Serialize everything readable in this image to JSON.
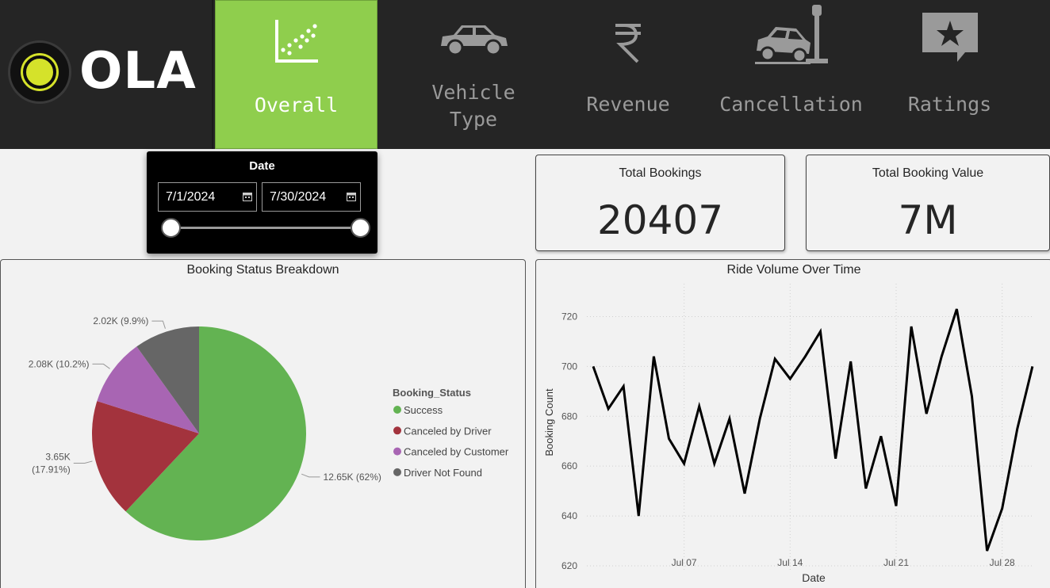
{
  "brand": {
    "name": "OLA"
  },
  "nav": {
    "tabs": [
      {
        "label": "Overall",
        "active": true,
        "icon": "scatter-chart-icon"
      },
      {
        "label_lines": [
          "Vehicle",
          "Type"
        ],
        "active": false,
        "icon": "car-icon"
      },
      {
        "label": "Revenue",
        "active": false,
        "icon": "rupee-icon"
      },
      {
        "label": "Cancellation",
        "active": false,
        "icon": "car-crash-icon"
      },
      {
        "label": "Ratings",
        "active": false,
        "icon": "star-badge-icon"
      }
    ],
    "active_color": "#8fce4d"
  },
  "date_filter": {
    "title": "Date",
    "start": "7/1/2024",
    "end": "7/30/2024"
  },
  "kpis": {
    "total_bookings": {
      "title": "Total Bookings",
      "value": "20407"
    },
    "total_booking_value": {
      "title": "Total Booking Value",
      "value": "7M"
    }
  },
  "chart_data": [
    {
      "type": "pie",
      "title": "Booking Status Breakdown",
      "legend_title": "Booking_Status",
      "legend_position": "right",
      "slices": [
        {
          "name": "Success",
          "value": 12.65,
          "label": "12.65K (62%)",
          "color": "#63b352"
        },
        {
          "name": "Canceled by Driver",
          "value": 3.65,
          "label_lines": [
            "3.65K",
            "(17.91%)"
          ],
          "color": "#a3333d"
        },
        {
          "name": "Canceled by Customer",
          "value": 2.08,
          "label": "2.08K (10.2%)",
          "color": "#a865b3"
        },
        {
          "name": "Driver Not Found",
          "value": 2.02,
          "label": "2.02K (9.9%)",
          "color": "#666666"
        }
      ]
    },
    {
      "type": "line",
      "title": "Ride Volume Over Time",
      "xlabel": "Date",
      "ylabel": "Booking Count",
      "ylim": [
        620,
        730
      ],
      "yticks": [
        620,
        640,
        660,
        680,
        700,
        720
      ],
      "xticks": [
        "Jul 07",
        "Jul 14",
        "Jul 21",
        "Jul 28"
      ],
      "x": [
        "2024-07-01",
        "2024-07-02",
        "2024-07-03",
        "2024-07-04",
        "2024-07-05",
        "2024-07-06",
        "2024-07-07",
        "2024-07-08",
        "2024-07-09",
        "2024-07-10",
        "2024-07-11",
        "2024-07-12",
        "2024-07-13",
        "2024-07-14",
        "2024-07-15",
        "2024-07-16",
        "2024-07-17",
        "2024-07-18",
        "2024-07-19",
        "2024-07-20",
        "2024-07-21",
        "2024-07-22",
        "2024-07-23",
        "2024-07-24",
        "2024-07-25",
        "2024-07-26",
        "2024-07-27",
        "2024-07-28",
        "2024-07-29",
        "2024-07-30"
      ],
      "values": [
        700,
        683,
        692,
        640,
        704,
        671,
        661,
        684,
        661,
        679,
        649,
        679,
        703,
        695,
        704,
        714,
        663,
        702,
        651,
        672,
        644,
        716,
        681,
        704,
        723,
        688,
        626,
        643,
        675,
        700
      ],
      "grid": true,
      "line_color": "#000000"
    }
  ]
}
